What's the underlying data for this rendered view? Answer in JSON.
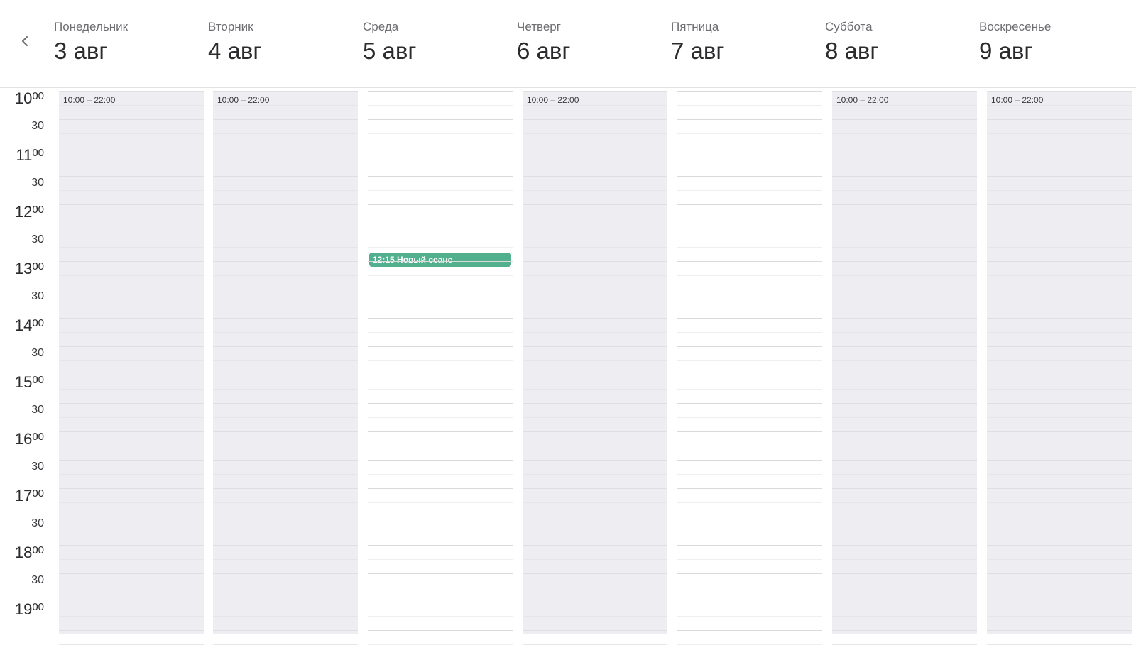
{
  "nav": {
    "prev_icon": "chevron-left-icon"
  },
  "days": [
    {
      "name": "Понедельник",
      "date": "3 авг",
      "hours": "10:00 – 22:00",
      "status": "closed"
    },
    {
      "name": "Вторник",
      "date": "4 авг",
      "hours": "10:00 – 22:00",
      "status": "closed"
    },
    {
      "name": "Среда",
      "date": "5 авг",
      "hours": "",
      "status": "open"
    },
    {
      "name": "Четверг",
      "date": "6 авг",
      "hours": "10:00 – 22:00",
      "status": "closed"
    },
    {
      "name": "Пятница",
      "date": "7 авг",
      "hours": "",
      "status": "open"
    },
    {
      "name": "Суббота",
      "date": "8 авг",
      "hours": "10:00 – 22:00",
      "status": "closed"
    },
    {
      "name": "Воскресенье",
      "date": "9 авг",
      "hours": "10:00 – 22:00",
      "status": "closed"
    }
  ],
  "time_axis": {
    "hours": [
      "10",
      "11",
      "12",
      "13",
      "14",
      "15",
      "16",
      "17",
      "18",
      "19"
    ],
    "minutes_full": "00",
    "minutes_half": "30"
  },
  "events": [
    {
      "day": "Среда",
      "label": "12:15 Новый сеанс",
      "start": "12:15",
      "color": "#52b08e"
    }
  ],
  "colors": {
    "closed_background": "#eeeef2",
    "open_background": "#ffffff",
    "event": "#52b08e"
  }
}
